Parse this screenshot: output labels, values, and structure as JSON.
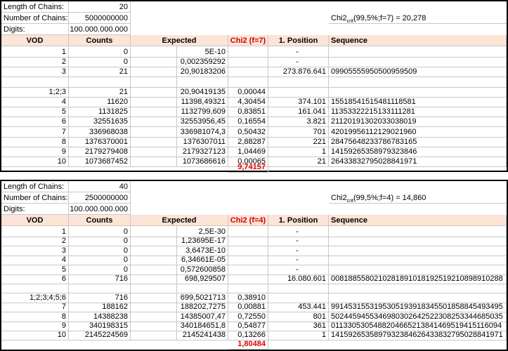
{
  "block1": {
    "length_label": "Length of Chains:",
    "length_value": "20",
    "number_label": "Number of Chains:",
    "number_value": "5000000000",
    "crit_text": "Chi2crit(99,5%;f=7) = 20,278",
    "digits_label": "Digits:",
    "digits_value": "100.000.000.000",
    "headers": [
      "VOD",
      "Counts",
      "Expected",
      "Chi2 (f=7)",
      "1. Position",
      "Sequence"
    ],
    "rows": [
      [
        "1",
        "0",
        "5E-10",
        "",
        "-",
        ""
      ],
      [
        "2",
        "0",
        "0,002359292",
        "",
        "-",
        ""
      ],
      [
        "3",
        "21",
        "20,90183206",
        "",
        "273.876.641",
        "09905555950500959509"
      ],
      [
        "",
        "",
        "",
        "",
        "",
        ""
      ],
      [
        "1;2;3",
        "21",
        "20,90419135",
        "0,00044",
        "",
        ""
      ],
      [
        "4",
        "11620",
        "11398,49321",
        "4,30454",
        "374.101",
        "15518541515481118581"
      ],
      [
        "5",
        "1131825",
        "1132799,609",
        "0,83851",
        "161.041",
        "11353322215133111281"
      ],
      [
        "6",
        "32551635",
        "32553956,45",
        "0,16554",
        "3.821",
        "21120191302033038019"
      ],
      [
        "7",
        "336968038",
        "336981074,3",
        "0,50432",
        "701",
        "42019956112129021960"
      ],
      [
        "8",
        "1376370001",
        "1376307011",
        "2,88287",
        "221",
        "28475648233786783165"
      ],
      [
        "9",
        "2179279408",
        "2179327123",
        "1,04469",
        "1",
        "14159265358979323846"
      ],
      [
        "10",
        "1073687452",
        "1073686616",
        "0,00065",
        "21",
        "26433832795028841971"
      ]
    ],
    "total": "9,74157"
  },
  "block2": {
    "length_label": "Length of Chains:",
    "length_value": "40",
    "number_label": "Number of Chains:",
    "number_value": "2500000000",
    "crit_text": "Chi2crit(99,5%;f=4) = 14,860",
    "digits_label": "Digits:",
    "digits_value": "100.000.000.000",
    "headers": [
      "VOD",
      "Counts",
      "Expected",
      "Chi2 (f=4)",
      "1. Position",
      "Sequence"
    ],
    "rows": [
      [
        "1",
        "0",
        "2,5E-30",
        "",
        "-",
        ""
      ],
      [
        "2",
        "0",
        "1,23695E-17",
        "",
        "-",
        ""
      ],
      [
        "3",
        "0",
        "3,6473E-10",
        "",
        "-",
        ""
      ],
      [
        "4",
        "0",
        "6,34661E-05",
        "",
        "-",
        ""
      ],
      [
        "5",
        "0",
        "0,572600858",
        "",
        "-",
        ""
      ],
      [
        "6",
        "716",
        "698,929507",
        "",
        "16.080.601",
        "0081885580210281891018192519210898910288"
      ],
      [
        "",
        "",
        "",
        "",
        "",
        ""
      ],
      [
        "1;2;3;4;5;6",
        "716",
        "699,5021713",
        "0,38910",
        "",
        ""
      ],
      [
        "7",
        "188162",
        "188202,7275",
        "0,00881",
        "453.441",
        "9914531553195305193918345501858845493495"
      ],
      [
        "8",
        "14388238",
        "14385007,47",
        "0,72550",
        "801",
        "5024459455346980302642522308253344685035"
      ],
      [
        "9",
        "340198315",
        "340184651,8",
        "0,54877",
        "361",
        "0113305305488204665213841469519415116094"
      ],
      [
        "10",
        "2145224569",
        "2145241438",
        "0,13266",
        "1",
        "1415926535897932384626433832795028841971"
      ]
    ],
    "total": "1,80484"
  }
}
